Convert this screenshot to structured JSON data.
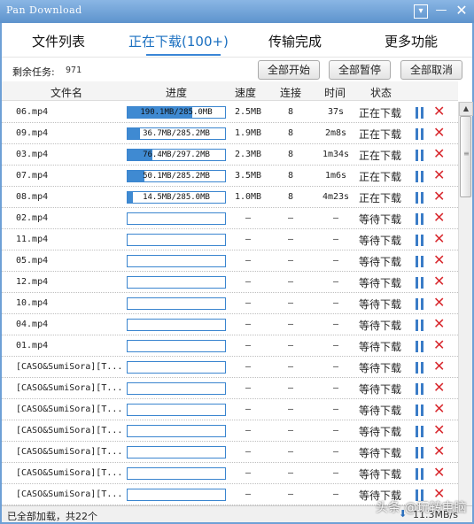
{
  "window": {
    "title": "Pan Download",
    "menu_icon": "dropdown-box-icon",
    "min_icon": "minimize-icon",
    "close_icon": "close-icon"
  },
  "tabs": [
    {
      "label": "文件列表",
      "active": false
    },
    {
      "label": "正在下载(100+)",
      "active": true
    },
    {
      "label": "传输完成",
      "active": false
    },
    {
      "label": "更多功能",
      "active": false
    }
  ],
  "toolbar": {
    "remaining_label": "剩余任务:",
    "remaining_count": "971",
    "start_all": "全部开始",
    "pause_all": "全部暂停",
    "cancel_all": "全部取消"
  },
  "columns": [
    "文件名",
    "进度",
    "速度",
    "连接",
    "时间",
    "状态"
  ],
  "rows": [
    {
      "name": "06.mp4",
      "progress_text": "190.1MB/285.0MB",
      "progress": 0.667,
      "speed": "2.5MB",
      "conn": "8",
      "time": "37s",
      "status": "正在下载"
    },
    {
      "name": "09.mp4",
      "progress_text": "36.7MB/285.2MB",
      "progress": 0.129,
      "speed": "1.9MB",
      "conn": "8",
      "time": "2m8s",
      "status": "正在下载"
    },
    {
      "name": "03.mp4",
      "progress_text": "76.4MB/297.2MB",
      "progress": 0.257,
      "speed": "2.3MB",
      "conn": "8",
      "time": "1m34s",
      "status": "正在下载"
    },
    {
      "name": "07.mp4",
      "progress_text": "50.1MB/285.2MB",
      "progress": 0.176,
      "speed": "3.5MB",
      "conn": "8",
      "time": "1m6s",
      "status": "正在下载"
    },
    {
      "name": "08.mp4",
      "progress_text": "14.5MB/285.0MB",
      "progress": 0.051,
      "speed": "1.0MB",
      "conn": "8",
      "time": "4m23s",
      "status": "正在下载"
    },
    {
      "name": "02.mp4",
      "progress_text": "",
      "progress": 0,
      "speed": "–",
      "conn": "–",
      "time": "–",
      "status": "等待下载"
    },
    {
      "name": "11.mp4",
      "progress_text": "",
      "progress": 0,
      "speed": "–",
      "conn": "–",
      "time": "–",
      "status": "等待下载"
    },
    {
      "name": "05.mp4",
      "progress_text": "",
      "progress": 0,
      "speed": "–",
      "conn": "–",
      "time": "–",
      "status": "等待下载"
    },
    {
      "name": "12.mp4",
      "progress_text": "",
      "progress": 0,
      "speed": "–",
      "conn": "–",
      "time": "–",
      "status": "等待下载"
    },
    {
      "name": "10.mp4",
      "progress_text": "",
      "progress": 0,
      "speed": "–",
      "conn": "–",
      "time": "–",
      "status": "等待下载"
    },
    {
      "name": "04.mp4",
      "progress_text": "",
      "progress": 0,
      "speed": "–",
      "conn": "–",
      "time": "–",
      "status": "等待下载"
    },
    {
      "name": "01.mp4",
      "progress_text": "",
      "progress": 0,
      "speed": "–",
      "conn": "–",
      "time": "–",
      "status": "等待下载"
    },
    {
      "name": "[CASO&SumiSora][T...",
      "progress_text": "",
      "progress": 0,
      "speed": "–",
      "conn": "–",
      "time": "–",
      "status": "等待下载"
    },
    {
      "name": "[CASO&SumiSora][T...",
      "progress_text": "",
      "progress": 0,
      "speed": "–",
      "conn": "–",
      "time": "–",
      "status": "等待下载"
    },
    {
      "name": "[CASO&SumiSora][T...",
      "progress_text": "",
      "progress": 0,
      "speed": "–",
      "conn": "–",
      "time": "–",
      "status": "等待下载"
    },
    {
      "name": "[CASO&SumiSora][T...",
      "progress_text": "",
      "progress": 0,
      "speed": "–",
      "conn": "–",
      "time": "–",
      "status": "等待下载"
    },
    {
      "name": "[CASO&SumiSora][T...",
      "progress_text": "",
      "progress": 0,
      "speed": "–",
      "conn": "–",
      "time": "–",
      "status": "等待下载"
    },
    {
      "name": "[CASO&SumiSora][T...",
      "progress_text": "",
      "progress": 0,
      "speed": "–",
      "conn": "–",
      "time": "–",
      "status": "等待下载"
    },
    {
      "name": "[CASO&SumiSora][T...",
      "progress_text": "",
      "progress": 0,
      "speed": "–",
      "conn": "–",
      "time": "–",
      "status": "等待下载"
    }
  ],
  "statusbar": {
    "text": "已全部加载，共22个",
    "speed_icon": "download-arrow-icon",
    "speed_text": "11.3MB/s"
  },
  "watermark": "头条 @玩转电脑"
}
